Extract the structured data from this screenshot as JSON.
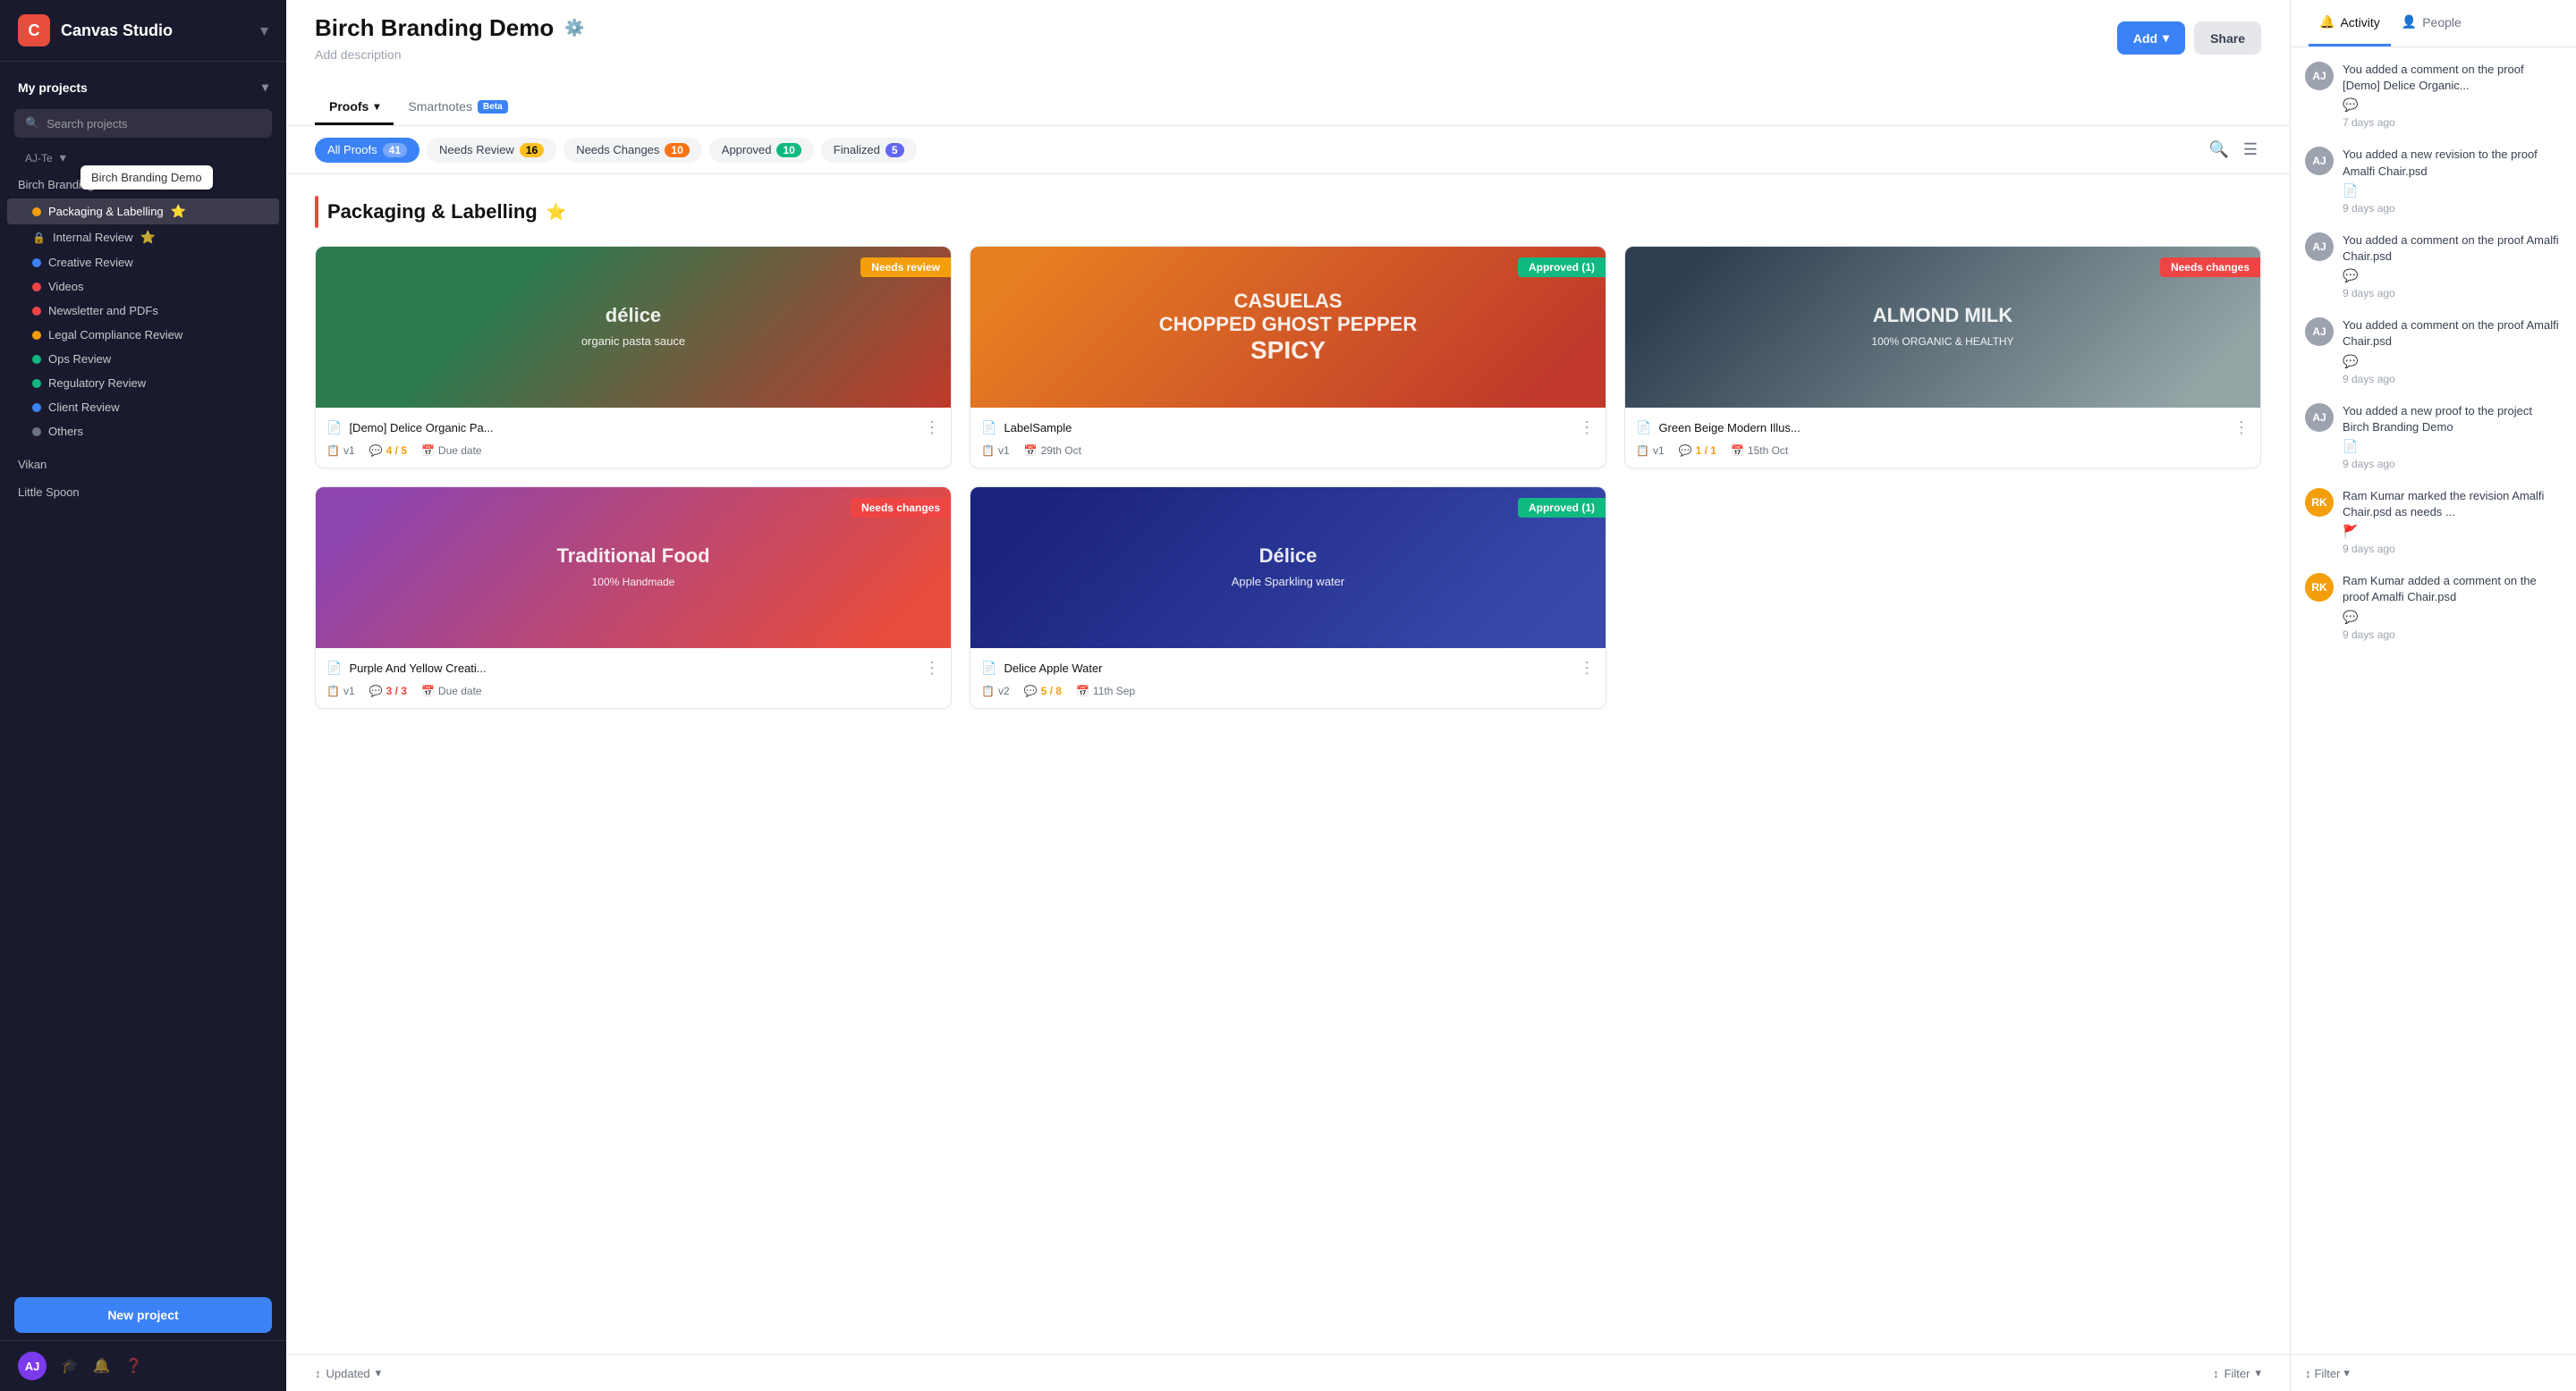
{
  "app": {
    "title": "Canvas Studio",
    "icon": "C"
  },
  "sidebar": {
    "my_projects_label": "My projects",
    "search_placeholder": "Search projects",
    "tooltip": "Birch Branding Demo",
    "projects": [
      {
        "name": "Birch Branding Demo",
        "items": [
          {
            "label": "Packaging & Labelling",
            "color": "#f59e0b",
            "star": true
          },
          {
            "label": "Internal Review",
            "color": "#ef4444",
            "locked": true,
            "star": true
          },
          {
            "label": "Creative Review",
            "color": "#3b82f6"
          },
          {
            "label": "Videos",
            "color": "#ef4444"
          },
          {
            "label": "Newsletter and PDFs",
            "color": "#ef4444"
          },
          {
            "label": "Legal Compliance Review",
            "color": "#f59e0b"
          },
          {
            "label": "Ops Review",
            "color": "#10b981"
          },
          {
            "label": "Regulatory Review",
            "color": "#10b981"
          },
          {
            "label": "Client Review",
            "color": "#3b82f6"
          },
          {
            "label": "Others",
            "color": "#6b7280"
          }
        ]
      },
      {
        "name": "Vikan",
        "items": []
      },
      {
        "name": "Little Spoon",
        "items": []
      }
    ],
    "new_project_label": "New project"
  },
  "main": {
    "title": "Birch Branding Demo",
    "add_desc": "Add description",
    "tabs": [
      {
        "label": "Proofs",
        "active": true
      },
      {
        "label": "Smartnotes",
        "beta": true
      }
    ],
    "filters": [
      {
        "label": "All Proofs",
        "count": "41",
        "active": true,
        "count_style": "white"
      },
      {
        "label": "Needs Review",
        "count": "16",
        "active": false,
        "count_style": "dark"
      },
      {
        "label": "Needs Changes",
        "count": "10",
        "active": false,
        "count_style": "needs-changes"
      },
      {
        "label": "Approved",
        "count": "10",
        "active": false,
        "count_style": "green"
      },
      {
        "label": "Finalized",
        "count": "5",
        "active": false,
        "count_style": "finalized"
      }
    ],
    "section_title": "Packaging & Labelling",
    "section_has_star": true,
    "proofs": [
      {
        "id": 1,
        "name": "[Demo] Delice Organic Pa...",
        "status": "Needs review",
        "status_class": "badge-needs-review",
        "version": "v1",
        "comments": "4 / 5",
        "comment_color": "orange",
        "due": "Due date",
        "bg_class": "img-delice",
        "bg_text": "délice",
        "bg_sub": "organic pasta sauce"
      },
      {
        "id": 2,
        "name": "LabelSample",
        "status": "Approved (1)",
        "status_class": "badge-approved",
        "version": "v1",
        "comments": null,
        "due": "29th Oct",
        "bg_class": "img-spicy",
        "bg_text": "SPICY",
        "bg_sub": "CASUELAS CHOPPED GHOST PEPPER"
      },
      {
        "id": 3,
        "name": "Green Beige Modern Illus...",
        "status": "Needs changes",
        "status_class": "badge-needs-changes",
        "version": "v1",
        "comments": "1 / 1",
        "comment_color": "orange",
        "due": "15th Oct",
        "bg_class": "img-almond",
        "bg_text": "ALMOND MILK",
        "bg_sub": "100% ORGANIC & HEALTHY"
      },
      {
        "id": 4,
        "name": "Purple And Yellow Creati...",
        "status": "Needs changes",
        "status_class": "badge-needs-changes",
        "version": "v1",
        "comments": "3 / 3",
        "comment_color": "red",
        "due": "Due date",
        "bg_class": "img-traditional",
        "bg_text": "Traditional Food",
        "bg_sub": "100% Handmade"
      },
      {
        "id": 5,
        "name": "Delice Apple Water",
        "status": "Approved (1)",
        "status_class": "badge-approved",
        "version": "v2",
        "comments": "5 / 8",
        "comment_color": "orange",
        "due": "11th Sep",
        "bg_class": "img-apple",
        "bg_text": "Délice",
        "bg_sub": "Apple Sparkling water"
      }
    ],
    "status_bar": {
      "updated": "Updated",
      "filter": "Filter"
    }
  },
  "right_panel": {
    "tabs": [
      {
        "label": "Activity",
        "active": true,
        "icon": "🔔"
      },
      {
        "label": "People",
        "active": false,
        "icon": "👤"
      }
    ],
    "activities": [
      {
        "avatar": "AJ",
        "avatar_color": "#9ca3af",
        "text": "You added a comment on the proof [Demo] Delice Organic...",
        "time": "7 days ago",
        "type": "comment"
      },
      {
        "avatar": "AJ",
        "avatar_color": "#9ca3af",
        "text": "You added a new revision to the proof Amalfi Chair.psd",
        "time": "9 days ago",
        "type": "file"
      },
      {
        "avatar": "AJ",
        "avatar_color": "#9ca3af",
        "text": "You added a comment on the proof Amalfi Chair.psd",
        "time": "9 days ago",
        "type": "comment"
      },
      {
        "avatar": "AJ",
        "avatar_color": "#9ca3af",
        "text": "You added a comment on the proof Amalfi Chair.psd",
        "time": "9 days ago",
        "type": "comment"
      },
      {
        "avatar": "AJ",
        "avatar_color": "#9ca3af",
        "text": "You added a new proof to the project Birch Branding Demo",
        "time": "9 days ago",
        "type": "file"
      },
      {
        "avatar": "RK",
        "avatar_color": "#f59e0b",
        "text": "Ram Kumar marked the revision Amalfi Chair.psd as needs ...",
        "time": "9 days ago",
        "type": "flag"
      },
      {
        "avatar": "RK",
        "avatar_color": "#f59e0b",
        "text": "Ram Kumar added a comment on the proof Amalfi Chair.psd",
        "time": "9 days ago",
        "type": "comment"
      }
    ],
    "filter_label": "Filter"
  },
  "header": {
    "add_label": "Add",
    "share_label": "Share"
  }
}
